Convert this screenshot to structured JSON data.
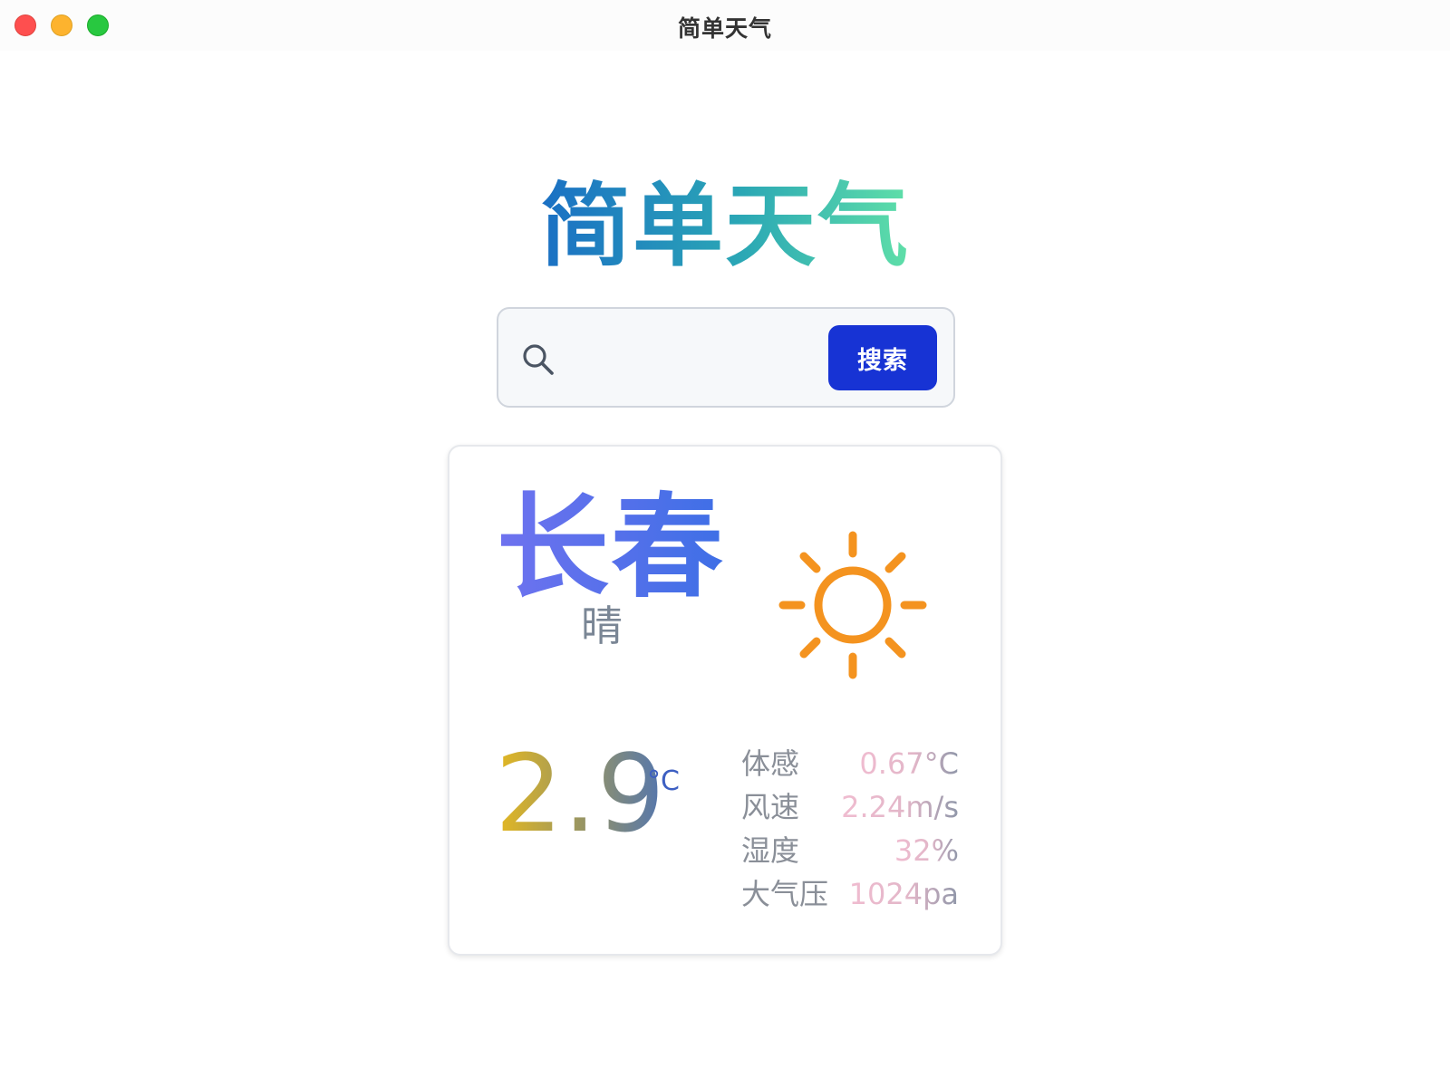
{
  "window": {
    "title": "简单天气",
    "controls": [
      "close",
      "minimize",
      "maximize"
    ]
  },
  "app_title": "简单天气",
  "search": {
    "value": "",
    "placeholder": "",
    "button_label": "搜索",
    "icon": "search-icon"
  },
  "weather": {
    "city": "长春",
    "condition": "晴",
    "icon": "sun-icon",
    "temperature": "2.9",
    "temperature_unit": "°C",
    "details": [
      {
        "label": "体感",
        "value": "0.67°C"
      },
      {
        "label": "风速",
        "value": "2.24m/s"
      },
      {
        "label": "湿度",
        "value": "32%"
      },
      {
        "label": "大气压",
        "value": "1024pa"
      }
    ]
  },
  "colors": {
    "search_button": "#1733d4",
    "sun_icon": "#f4931f",
    "title_gradient_start": "#1a6fc4",
    "title_gradient_end": "#5fdfa8"
  }
}
